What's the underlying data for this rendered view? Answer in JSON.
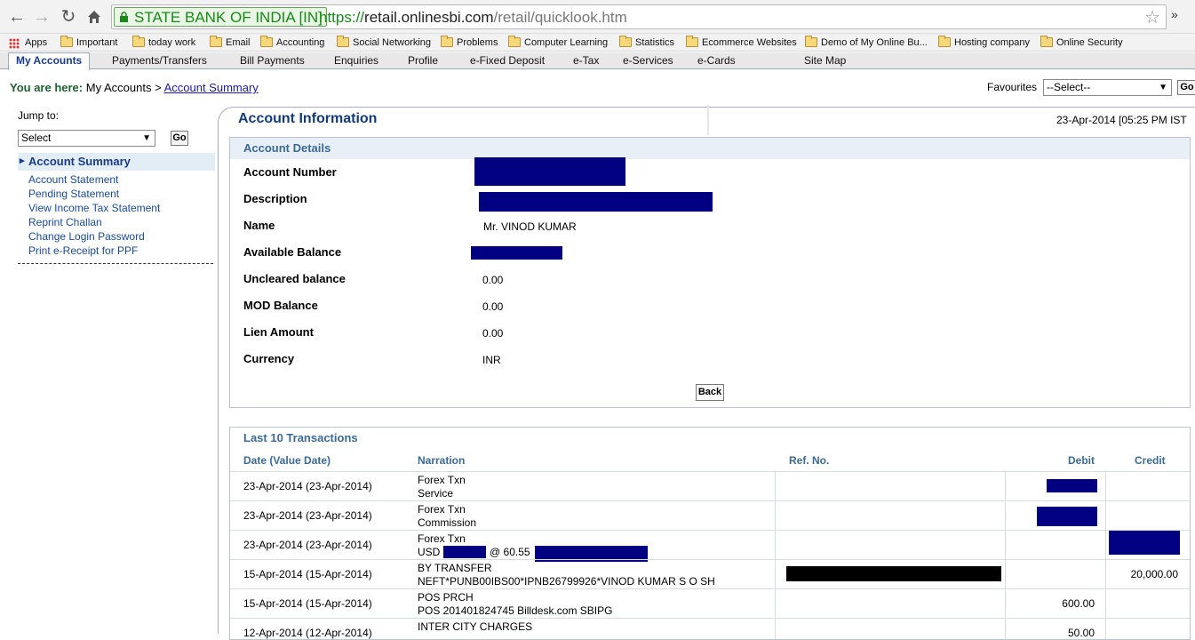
{
  "browser": {
    "ev_label": "STATE BANK OF INDIA [IN]",
    "url_scheme": "https://",
    "url_host": "retail.onlinesbi.com",
    "url_path": "/retail/quicklook.htm",
    "extension_glyph": "»",
    "bookmarks": [
      "Apps",
      "Important",
      "today work",
      "Email",
      "Accounting",
      "Social Networking",
      "Problems",
      "Computer Learning",
      "Statistics",
      "Ecommerce Websites",
      "Demo of My Online Bu...",
      "Hosting company",
      "Online Security"
    ]
  },
  "menu": [
    "My Accounts",
    "Payments/Transfers",
    "Bill Payments",
    "Enquiries",
    "Profile",
    "e-Fixed Deposit",
    "e-Tax",
    "e-Services",
    "e-Cards",
    "Site Map"
  ],
  "breadcrumb": {
    "label": "You are here:",
    "root": "My Accounts",
    "separator": ">",
    "current": "Account Summary"
  },
  "favourites": {
    "label": "Favourites",
    "selected": "--Select--",
    "go": "Go"
  },
  "sidebar": {
    "jump_label": "Jump to:",
    "jump_selected": "Select",
    "go": "Go",
    "current": "Account Summary",
    "links": [
      "Account Statement",
      "Pending Statement",
      "View Income Tax Statement",
      "Reprint Challan",
      "Change Login Password",
      "Print e-Receipt for PPF"
    ]
  },
  "main": {
    "title": "Account Information",
    "datetime": "23-Apr-2014 [05:25 PM IST"
  },
  "account_details": {
    "heading": "Account Details",
    "labels": [
      "Account Number",
      "Description",
      "Name",
      "Available Balance",
      "Uncleared balance",
      "MOD Balance",
      "Lien Amount",
      "Currency"
    ],
    "name": "Mr. VINOD KUMAR",
    "uncleared": "0.00",
    "mod": "0.00",
    "lien": "0.00",
    "currency": "INR",
    "back": "Back"
  },
  "transactions": {
    "heading": "Last 10 Transactions",
    "columns": [
      "Date (Value Date)",
      "Narration",
      "Ref. No.",
      "Debit",
      "Credit"
    ],
    "rows": [
      {
        "date": "23-Apr-2014 (23-Apr-2014)",
        "line1": "Forex Txn",
        "line2": "Service",
        "debit": "",
        "credit": ""
      },
      {
        "date": "23-Apr-2014 (23-Apr-2014)",
        "line1": "Forex Txn",
        "line2": "Commission",
        "debit": "",
        "credit": ""
      },
      {
        "date": "23-Apr-2014 (23-Apr-2014)",
        "line1": "Forex Txn",
        "line2": "USD",
        "line2b": "@ 60.55",
        "debit": "",
        "credit": ""
      },
      {
        "date": "15-Apr-2014 (15-Apr-2014)",
        "line1": "BY TRANSFER",
        "line2": "NEFT*PUNB00IBS00*IPNB26799926*VINOD KUMAR S O SH",
        "debit": "",
        "credit": "20,000.00"
      },
      {
        "date": "15-Apr-2014 (15-Apr-2014)",
        "line1": "POS PRCH",
        "line2": "POS 201401824745 Billdesk.com SBIPG",
        "debit": "600.00",
        "credit": ""
      },
      {
        "date": "12-Apr-2014 (12-Apr-2014)",
        "line1": "INTER CITY CHARGES",
        "line2": "",
        "debit": "50.00",
        "credit": ""
      }
    ]
  }
}
